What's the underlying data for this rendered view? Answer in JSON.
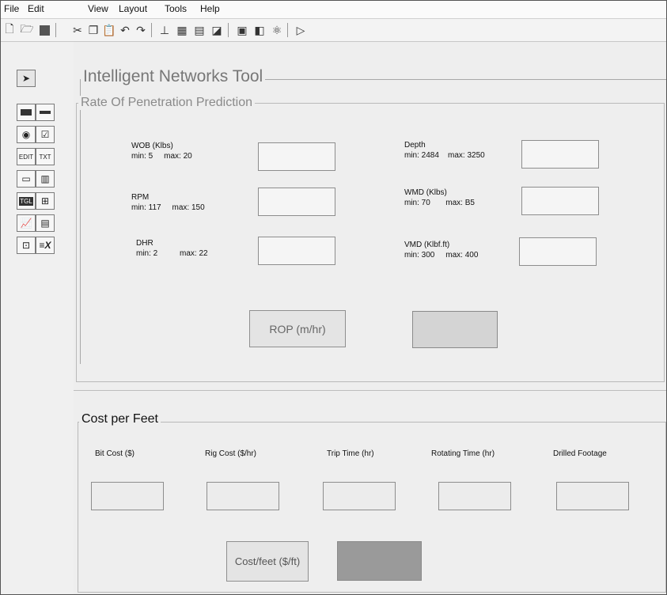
{
  "menu": [
    "File",
    "Edit",
    "View",
    "Layout",
    "Tools",
    "Help"
  ],
  "toolbar_icons": [
    "new-file-icon",
    "open-folder-icon",
    "save-icon",
    "cut-icon",
    "copy-icon",
    "paste-icon",
    "undo-icon",
    "redo-icon",
    "align-icon",
    "editor-icon",
    "tab-order-icon",
    "menu-editor-icon",
    "property-inspector-icon",
    "object-browser-icon",
    "m-file-icon",
    "run-icon"
  ],
  "palette_icons": [
    "select-arrow-icon",
    "push-button-icon",
    "slider-icon",
    "radio-button-icon",
    "checkbox-icon",
    "edit-text-icon",
    "static-text-icon",
    "popup-menu-icon",
    "listbox-icon",
    "toggle-button-icon",
    "table-icon",
    "axes-icon",
    "panel-icon",
    "button-group-icon",
    "activex-icon"
  ],
  "app_title": "Intelligent Networks Tool",
  "rop_panel": {
    "title": "Rate Of Penetration Prediction",
    "inputs": [
      {
        "name": "WOB (Klbs)",
        "range": "min: 5     max: 20"
      },
      {
        "name": "RPM",
        "range": "min: 117     max: 150"
      },
      {
        "name": "DHR",
        "range": "min: 2          max: 22"
      },
      {
        "name": "Depth",
        "range": "min: 2484    max: 3250"
      },
      {
        "name": "WMD (Klbs)",
        "range": "min: 70       max: B5"
      },
      {
        "name": "VMD   (Klbf.ft)",
        "range": "min: 300     max: 400"
      }
    ],
    "button": "ROP (m/hr)",
    "output_color": "#d4d4d4"
  },
  "cost_panel": {
    "title": "Cost per Feet",
    "columns": [
      "Bit Cost ($)",
      "Rig Cost ($/hr)",
      "Trip Time (hr)",
      "Rotating Time (hr)",
      "Drilled Footage"
    ],
    "button": "Cost/feet ($/ft)",
    "output_color": "#9a9a9a"
  }
}
